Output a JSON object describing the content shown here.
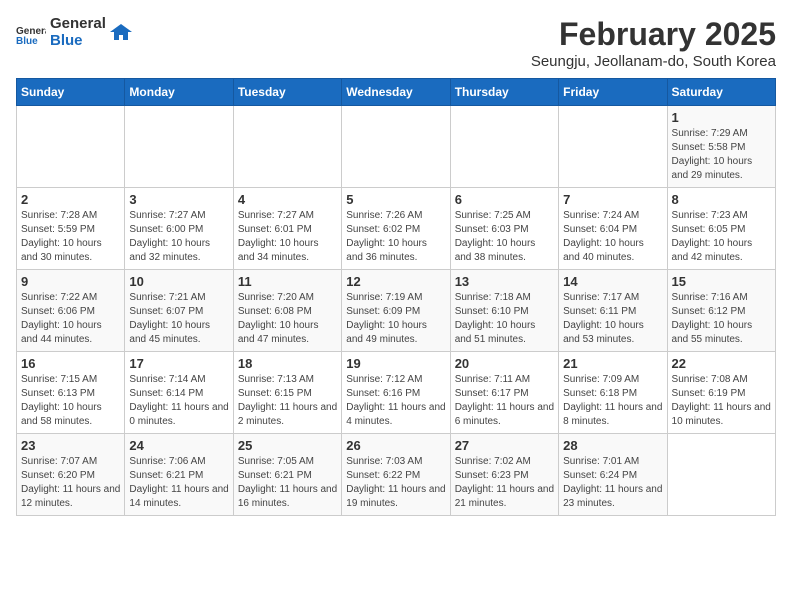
{
  "header": {
    "logo_general": "General",
    "logo_blue": "Blue",
    "title": "February 2025",
    "subtitle": "Seungju, Jeollanam-do, South Korea"
  },
  "weekdays": [
    "Sunday",
    "Monday",
    "Tuesday",
    "Wednesday",
    "Thursday",
    "Friday",
    "Saturday"
  ],
  "weeks": [
    [
      {
        "day": "",
        "info": ""
      },
      {
        "day": "",
        "info": ""
      },
      {
        "day": "",
        "info": ""
      },
      {
        "day": "",
        "info": ""
      },
      {
        "day": "",
        "info": ""
      },
      {
        "day": "",
        "info": ""
      },
      {
        "day": "1",
        "info": "Sunrise: 7:29 AM\nSunset: 5:58 PM\nDaylight: 10 hours and 29 minutes."
      }
    ],
    [
      {
        "day": "2",
        "info": "Sunrise: 7:28 AM\nSunset: 5:59 PM\nDaylight: 10 hours and 30 minutes."
      },
      {
        "day": "3",
        "info": "Sunrise: 7:27 AM\nSunset: 6:00 PM\nDaylight: 10 hours and 32 minutes."
      },
      {
        "day": "4",
        "info": "Sunrise: 7:27 AM\nSunset: 6:01 PM\nDaylight: 10 hours and 34 minutes."
      },
      {
        "day": "5",
        "info": "Sunrise: 7:26 AM\nSunset: 6:02 PM\nDaylight: 10 hours and 36 minutes."
      },
      {
        "day": "6",
        "info": "Sunrise: 7:25 AM\nSunset: 6:03 PM\nDaylight: 10 hours and 38 minutes."
      },
      {
        "day": "7",
        "info": "Sunrise: 7:24 AM\nSunset: 6:04 PM\nDaylight: 10 hours and 40 minutes."
      },
      {
        "day": "8",
        "info": "Sunrise: 7:23 AM\nSunset: 6:05 PM\nDaylight: 10 hours and 42 minutes."
      }
    ],
    [
      {
        "day": "9",
        "info": "Sunrise: 7:22 AM\nSunset: 6:06 PM\nDaylight: 10 hours and 44 minutes."
      },
      {
        "day": "10",
        "info": "Sunrise: 7:21 AM\nSunset: 6:07 PM\nDaylight: 10 hours and 45 minutes."
      },
      {
        "day": "11",
        "info": "Sunrise: 7:20 AM\nSunset: 6:08 PM\nDaylight: 10 hours and 47 minutes."
      },
      {
        "day": "12",
        "info": "Sunrise: 7:19 AM\nSunset: 6:09 PM\nDaylight: 10 hours and 49 minutes."
      },
      {
        "day": "13",
        "info": "Sunrise: 7:18 AM\nSunset: 6:10 PM\nDaylight: 10 hours and 51 minutes."
      },
      {
        "day": "14",
        "info": "Sunrise: 7:17 AM\nSunset: 6:11 PM\nDaylight: 10 hours and 53 minutes."
      },
      {
        "day": "15",
        "info": "Sunrise: 7:16 AM\nSunset: 6:12 PM\nDaylight: 10 hours and 55 minutes."
      }
    ],
    [
      {
        "day": "16",
        "info": "Sunrise: 7:15 AM\nSunset: 6:13 PM\nDaylight: 10 hours and 58 minutes."
      },
      {
        "day": "17",
        "info": "Sunrise: 7:14 AM\nSunset: 6:14 PM\nDaylight: 11 hours and 0 minutes."
      },
      {
        "day": "18",
        "info": "Sunrise: 7:13 AM\nSunset: 6:15 PM\nDaylight: 11 hours and 2 minutes."
      },
      {
        "day": "19",
        "info": "Sunrise: 7:12 AM\nSunset: 6:16 PM\nDaylight: 11 hours and 4 minutes."
      },
      {
        "day": "20",
        "info": "Sunrise: 7:11 AM\nSunset: 6:17 PM\nDaylight: 11 hours and 6 minutes."
      },
      {
        "day": "21",
        "info": "Sunrise: 7:09 AM\nSunset: 6:18 PM\nDaylight: 11 hours and 8 minutes."
      },
      {
        "day": "22",
        "info": "Sunrise: 7:08 AM\nSunset: 6:19 PM\nDaylight: 11 hours and 10 minutes."
      }
    ],
    [
      {
        "day": "23",
        "info": "Sunrise: 7:07 AM\nSunset: 6:20 PM\nDaylight: 11 hours and 12 minutes."
      },
      {
        "day": "24",
        "info": "Sunrise: 7:06 AM\nSunset: 6:21 PM\nDaylight: 11 hours and 14 minutes."
      },
      {
        "day": "25",
        "info": "Sunrise: 7:05 AM\nSunset: 6:21 PM\nDaylight: 11 hours and 16 minutes."
      },
      {
        "day": "26",
        "info": "Sunrise: 7:03 AM\nSunset: 6:22 PM\nDaylight: 11 hours and 19 minutes."
      },
      {
        "day": "27",
        "info": "Sunrise: 7:02 AM\nSunset: 6:23 PM\nDaylight: 11 hours and 21 minutes."
      },
      {
        "day": "28",
        "info": "Sunrise: 7:01 AM\nSunset: 6:24 PM\nDaylight: 11 hours and 23 minutes."
      },
      {
        "day": "",
        "info": ""
      }
    ]
  ]
}
